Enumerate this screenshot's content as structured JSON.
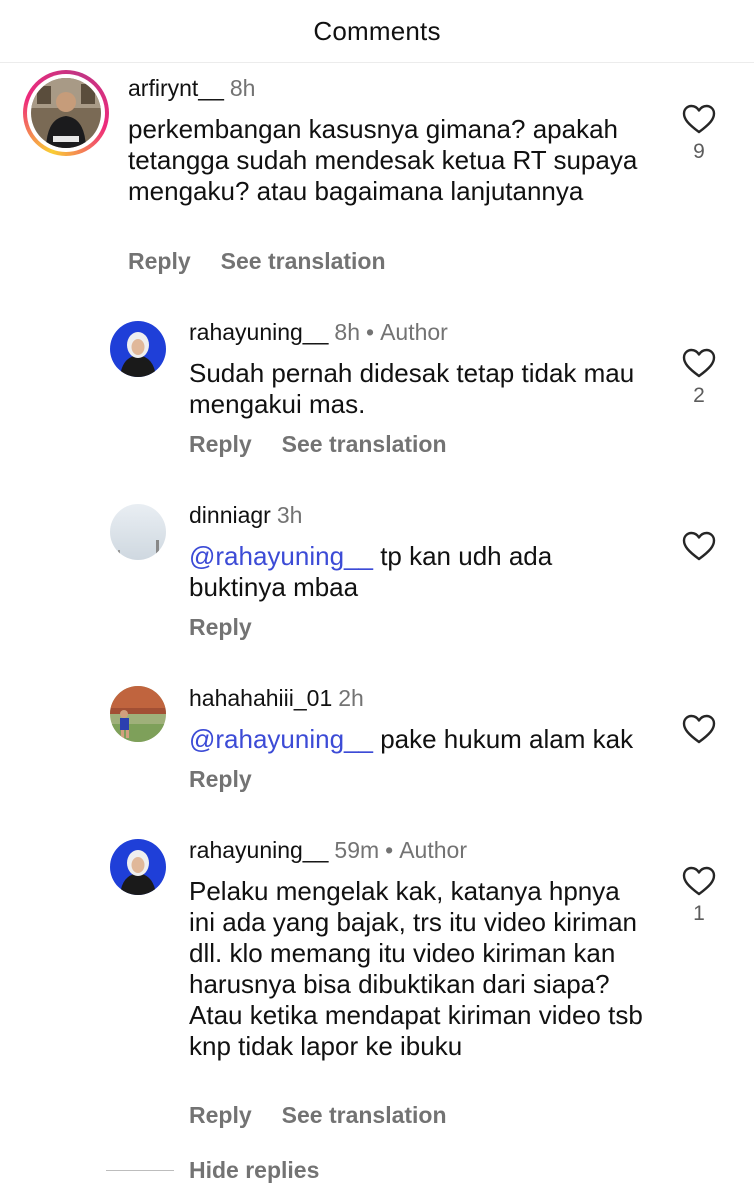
{
  "header": {
    "title": "Comments"
  },
  "comments": [
    {
      "username": "arfirynt__",
      "time": "8h",
      "author_tag": "",
      "text": "perkembangan kasusnya gimana? apakah tetangga sudah mendesak ketua RT supaya mengaku? atau bagaimana lanjutannya",
      "reply_label": "Reply",
      "translation_label": "See translation",
      "likes": "9"
    },
    {
      "username": "rahayuning__",
      "time": "8h",
      "author_tag": "Author",
      "text": "Sudah pernah didesak tetap tidak mau mengakui mas.",
      "reply_label": "Reply",
      "translation_label": "See translation",
      "likes": "2"
    },
    {
      "username": "dinniagr",
      "time": "3h",
      "mention": "@rahayuning__",
      "text": " tp kan udh ada buktinya mbaa",
      "reply_label": "Reply",
      "likes": ""
    },
    {
      "username": "hahahahiii_01",
      "time": "2h",
      "mention": "@rahayuning__",
      "text": " pake hukum alam kak",
      "reply_label": "Reply",
      "likes": ""
    },
    {
      "username": "rahayuning__",
      "time": "59m",
      "author_tag": "Author",
      "text": "Pelaku mengelak kak, katanya hpnya ini ada yang bajak, trs itu video kiriman dll. klo memang itu video kiriman kan harusnya bisa dibuktikan dari siapa? Atau ketika mendapat kiriman video tsb knp tidak lapor ke ibuku",
      "reply_label": "Reply",
      "translation_label": "See translation",
      "likes": "1"
    }
  ],
  "footer": {
    "hide_replies_label": "Hide replies"
  },
  "colors": {
    "mention": "#3c4bd6",
    "secondary": "#737373",
    "ring_gradient": [
      "#f9ce34",
      "#ee2a7b",
      "#c13584"
    ]
  },
  "icons": {
    "like": "heart-outline-icon"
  }
}
